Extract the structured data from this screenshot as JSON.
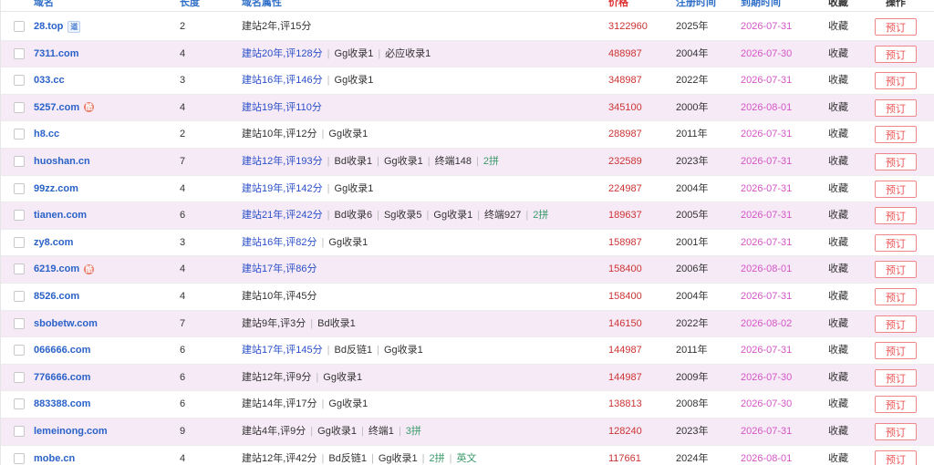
{
  "header": {
    "domain": "域名",
    "length": "长度",
    "attrs": "域名属性",
    "price": "价格",
    "reg": "注册时间",
    "expire": "到期时间",
    "fav": "收藏",
    "op": "操作"
  },
  "rows": [
    {
      "domain": "28.top",
      "badge": "道",
      "badge_type": "dao",
      "length": "2",
      "attrs": [
        {
          "t": "建站2年,评15分",
          "c": "plain"
        }
      ],
      "price": "3122960",
      "year": "2025年",
      "date": "2026-07-31",
      "fav": "收藏",
      "btn": "预订"
    },
    {
      "domain": "7311.com",
      "badge": "",
      "badge_type": "",
      "length": "4",
      "attrs": [
        {
          "t": "建站20年,评128分",
          "c": "blue"
        },
        {
          "t": "Gg收录1",
          "c": "plain"
        },
        {
          "t": "必应收录1",
          "c": "plain"
        }
      ],
      "price": "488987",
      "year": "2004年",
      "date": "2026-07-30",
      "fav": "收藏",
      "btn": "预订"
    },
    {
      "domain": "033.cc",
      "badge": "",
      "badge_type": "",
      "length": "3",
      "attrs": [
        {
          "t": "建站16年,评146分",
          "c": "blue"
        },
        {
          "t": "Gg收录1",
          "c": "plain"
        }
      ],
      "price": "348987",
      "year": "2022年",
      "date": "2026-07-31",
      "fav": "收藏",
      "btn": "预订"
    },
    {
      "domain": "5257.com",
      "badge": "酷",
      "badge_type": "ku",
      "length": "4",
      "attrs": [
        {
          "t": "建站19年,评110分",
          "c": "blue"
        }
      ],
      "price": "345100",
      "year": "2000年",
      "date": "2026-08-01",
      "fav": "收藏",
      "btn": "预订"
    },
    {
      "domain": "h8.cc",
      "badge": "",
      "badge_type": "",
      "length": "2",
      "attrs": [
        {
          "t": "建站10年,评12分",
          "c": "plain"
        },
        {
          "t": "Gg收录1",
          "c": "plain"
        }
      ],
      "price": "288987",
      "year": "2011年",
      "date": "2026-07-31",
      "fav": "收藏",
      "btn": "预订"
    },
    {
      "domain": "huoshan.cn",
      "badge": "",
      "badge_type": "",
      "length": "7",
      "attrs": [
        {
          "t": "建站12年,评193分",
          "c": "blue"
        },
        {
          "t": "Bd收录1",
          "c": "plain"
        },
        {
          "t": "Gg收录1",
          "c": "plain"
        },
        {
          "t": "终端148",
          "c": "plain"
        },
        {
          "t": "2拼",
          "c": "grn"
        }
      ],
      "price": "232589",
      "year": "2023年",
      "date": "2026-07-31",
      "fav": "收藏",
      "btn": "预订"
    },
    {
      "domain": "99zz.com",
      "badge": "",
      "badge_type": "",
      "length": "4",
      "attrs": [
        {
          "t": "建站19年,评142分",
          "c": "blue"
        },
        {
          "t": "Gg收录1",
          "c": "plain"
        }
      ],
      "price": "224987",
      "year": "2004年",
      "date": "2026-07-31",
      "fav": "收藏",
      "btn": "预订"
    },
    {
      "domain": "tianen.com",
      "badge": "",
      "badge_type": "",
      "length": "6",
      "attrs": [
        {
          "t": "建站21年,评242分",
          "c": "blue"
        },
        {
          "t": "Bd收录6",
          "c": "plain"
        },
        {
          "t": "Sg收录5",
          "c": "plain"
        },
        {
          "t": "Gg收录1",
          "c": "plain"
        },
        {
          "t": "终端927",
          "c": "plain"
        },
        {
          "t": "2拼",
          "c": "grn"
        }
      ],
      "price": "189637",
      "year": "2005年",
      "date": "2026-07-31",
      "fav": "收藏",
      "btn": "预订"
    },
    {
      "domain": "zy8.com",
      "badge": "",
      "badge_type": "",
      "length": "3",
      "attrs": [
        {
          "t": "建站16年,评82分",
          "c": "blue"
        },
        {
          "t": "Gg收录1",
          "c": "plain"
        }
      ],
      "price": "158987",
      "year": "2001年",
      "date": "2026-07-31",
      "fav": "收藏",
      "btn": "预订"
    },
    {
      "domain": "6219.com",
      "badge": "酷",
      "badge_type": "ku",
      "length": "4",
      "attrs": [
        {
          "t": "建站17年,评86分",
          "c": "blue"
        }
      ],
      "price": "158400",
      "year": "2006年",
      "date": "2026-08-01",
      "fav": "收藏",
      "btn": "预订"
    },
    {
      "domain": "8526.com",
      "badge": "",
      "badge_type": "",
      "length": "4",
      "attrs": [
        {
          "t": "建站10年,评45分",
          "c": "plain"
        }
      ],
      "price": "158400",
      "year": "2004年",
      "date": "2026-07-31",
      "fav": "收藏",
      "btn": "预订"
    },
    {
      "domain": "sbobetw.com",
      "badge": "",
      "badge_type": "",
      "length": "7",
      "attrs": [
        {
          "t": "建站9年,评3分",
          "c": "plain"
        },
        {
          "t": "Bd收录1",
          "c": "plain"
        }
      ],
      "price": "146150",
      "year": "2022年",
      "date": "2026-08-02",
      "fav": "收藏",
      "btn": "预订"
    },
    {
      "domain": "066666.com",
      "badge": "",
      "badge_type": "",
      "length": "6",
      "attrs": [
        {
          "t": "建站17年,评145分",
          "c": "blue"
        },
        {
          "t": "Bd反链1",
          "c": "plain"
        },
        {
          "t": "Gg收录1",
          "c": "plain"
        }
      ],
      "price": "144987",
      "year": "2011年",
      "date": "2026-07-31",
      "fav": "收藏",
      "btn": "预订"
    },
    {
      "domain": "776666.com",
      "badge": "",
      "badge_type": "",
      "length": "6",
      "attrs": [
        {
          "t": "建站12年,评9分",
          "c": "plain"
        },
        {
          "t": "Gg收录1",
          "c": "plain"
        }
      ],
      "price": "144987",
      "year": "2009年",
      "date": "2026-07-30",
      "fav": "收藏",
      "btn": "预订"
    },
    {
      "domain": "883388.com",
      "badge": "",
      "badge_type": "",
      "length": "6",
      "attrs": [
        {
          "t": "建站14年,评17分",
          "c": "plain"
        },
        {
          "t": "Gg收录1",
          "c": "plain"
        }
      ],
      "price": "138813",
      "year": "2008年",
      "date": "2026-07-30",
      "fav": "收藏",
      "btn": "预订"
    },
    {
      "domain": "lemeinong.com",
      "badge": "",
      "badge_type": "",
      "length": "9",
      "attrs": [
        {
          "t": "建站4年,评9分",
          "c": "plain"
        },
        {
          "t": "Gg收录1",
          "c": "plain"
        },
        {
          "t": "终端1",
          "c": "plain"
        },
        {
          "t": "3拼",
          "c": "grn"
        }
      ],
      "price": "128240",
      "year": "2023年",
      "date": "2026-07-31",
      "fav": "收藏",
      "btn": "预订"
    },
    {
      "domain": "mobe.cn",
      "badge": "",
      "badge_type": "",
      "length": "4",
      "attrs": [
        {
          "t": "建站12年,评42分",
          "c": "plain"
        },
        {
          "t": "Bd反链1",
          "c": "plain"
        },
        {
          "t": "Gg收录1",
          "c": "plain"
        },
        {
          "t": "2拼",
          "c": "grn"
        },
        {
          "t": "英文",
          "c": "grn"
        }
      ],
      "price": "117661",
      "year": "2024年",
      "date": "2026-08-01",
      "fav": "收藏",
      "btn": "预订"
    }
  ]
}
